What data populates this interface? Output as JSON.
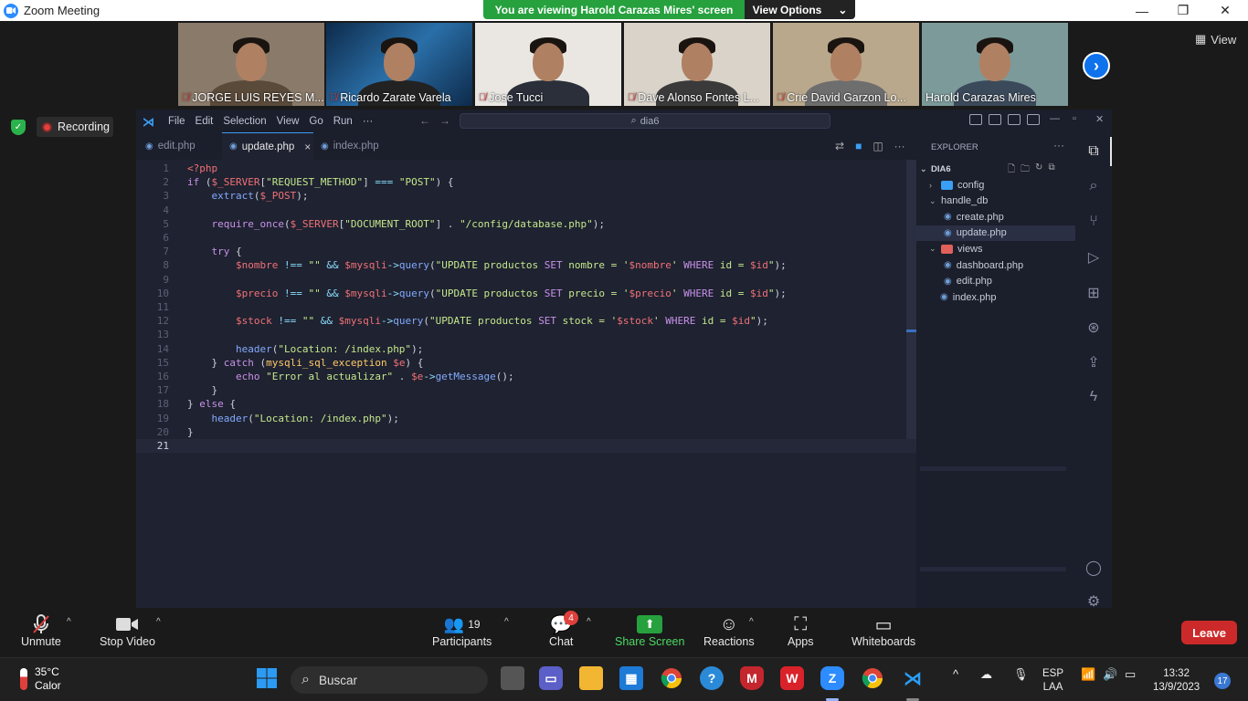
{
  "window": {
    "title": "Zoom Meeting",
    "controls": {
      "minimize": "—",
      "restore": "❐",
      "close": "✕"
    }
  },
  "share_banner": {
    "message": "You are viewing Harold Carazas Mires' screen",
    "options_label": "View Options"
  },
  "participants_strip": [
    {
      "name": "JORGE LUIS REYES M...",
      "muted": true,
      "bg": "#8a7a6a"
    },
    {
      "name": "Ricardo Zarate Varela",
      "muted": true,
      "bg": "#1f4e7a"
    },
    {
      "name": "Jose Tucci",
      "muted": true,
      "bg": "#e9e6e2"
    },
    {
      "name": "Dave Alonso Fontes L...",
      "muted": true,
      "bg": "#d8d2c8"
    },
    {
      "name": "Crie David Garzon Lo...",
      "muted": true,
      "bg": "#b9a88c"
    },
    {
      "name": "Harold Carazas Mires",
      "muted": false,
      "bg": "#7c9a9a"
    }
  ],
  "view_label": "View",
  "recording_label": "Recording",
  "vscode": {
    "menu": [
      "File",
      "Edit",
      "Selection",
      "View",
      "Go",
      "Run",
      "···"
    ],
    "search_text": "dia6",
    "tabs": [
      {
        "label": "edit.php",
        "active": false
      },
      {
        "label": "update.php",
        "active": true
      },
      {
        "label": "index.php",
        "active": false
      }
    ],
    "current_line": 21,
    "lines": [
      [
        [
          "tag",
          "<?php"
        ]
      ],
      [
        [
          "kw",
          "if"
        ],
        [
          "pl",
          " ("
        ],
        [
          "var",
          "$_SERVER"
        ],
        [
          "pl",
          "["
        ],
        [
          "str",
          "\"REQUEST_METHOD\""
        ],
        [
          "pl",
          "] "
        ],
        [
          "op",
          "==="
        ],
        [
          "pl",
          " "
        ],
        [
          "str",
          "\"POST\""
        ],
        [
          "pl",
          ") {"
        ]
      ],
      [
        [
          "pl",
          "    "
        ],
        [
          "fn",
          "extract"
        ],
        [
          "pl",
          "("
        ],
        [
          "var",
          "$_POST"
        ],
        [
          "pl",
          ");"
        ]
      ],
      [],
      [
        [
          "pl",
          "    "
        ],
        [
          "kw",
          "require_once"
        ],
        [
          "pl",
          "("
        ],
        [
          "var",
          "$_SERVER"
        ],
        [
          "pl",
          "["
        ],
        [
          "str",
          "\"DOCUMENT_ROOT\""
        ],
        [
          "pl",
          "] . "
        ],
        [
          "str",
          "\"/config/database.php\""
        ],
        [
          "pl",
          ");"
        ]
      ],
      [],
      [
        [
          "pl",
          "    "
        ],
        [
          "kw",
          "try"
        ],
        [
          "pl",
          " {"
        ]
      ],
      [
        [
          "pl",
          "        "
        ],
        [
          "var",
          "$nombre"
        ],
        [
          "pl",
          " "
        ],
        [
          "op",
          "!=="
        ],
        [
          "pl",
          " "
        ],
        [
          "str",
          "\"\""
        ],
        [
          "pl",
          " "
        ],
        [
          "op",
          "&&"
        ],
        [
          "pl",
          " "
        ],
        [
          "var",
          "$mysqli"
        ],
        [
          "op",
          "->"
        ],
        [
          "fn",
          "query"
        ],
        [
          "pl",
          "("
        ],
        [
          "str",
          "\"UPDATE productos "
        ],
        [
          "kw",
          "SET"
        ],
        [
          "str",
          " nombre = '"
        ],
        [
          "var",
          "$nombre"
        ],
        [
          "str",
          "' "
        ],
        [
          "kw",
          "WHERE"
        ],
        [
          "str",
          " id = "
        ],
        [
          "var",
          "$id"
        ],
        [
          "str",
          "\""
        ],
        [
          "pl",
          ");"
        ]
      ],
      [],
      [
        [
          "pl",
          "        "
        ],
        [
          "var",
          "$precio"
        ],
        [
          "pl",
          " "
        ],
        [
          "op",
          "!=="
        ],
        [
          "pl",
          " "
        ],
        [
          "str",
          "\"\""
        ],
        [
          "pl",
          " "
        ],
        [
          "op",
          "&&"
        ],
        [
          "pl",
          " "
        ],
        [
          "var",
          "$mysqli"
        ],
        [
          "op",
          "->"
        ],
        [
          "fn",
          "query"
        ],
        [
          "pl",
          "("
        ],
        [
          "str",
          "\"UPDATE productos "
        ],
        [
          "kw",
          "SET"
        ],
        [
          "str",
          " precio = '"
        ],
        [
          "var",
          "$precio"
        ],
        [
          "str",
          "' "
        ],
        [
          "kw",
          "WHERE"
        ],
        [
          "str",
          " id = "
        ],
        [
          "var",
          "$id"
        ],
        [
          "str",
          "\""
        ],
        [
          "pl",
          ");"
        ]
      ],
      [],
      [
        [
          "pl",
          "        "
        ],
        [
          "var",
          "$stock"
        ],
        [
          "pl",
          " "
        ],
        [
          "op",
          "!=="
        ],
        [
          "pl",
          " "
        ],
        [
          "str",
          "\"\""
        ],
        [
          "pl",
          " "
        ],
        [
          "op",
          "&&"
        ],
        [
          "pl",
          " "
        ],
        [
          "var",
          "$mysqli"
        ],
        [
          "op",
          "->"
        ],
        [
          "fn",
          "query"
        ],
        [
          "pl",
          "("
        ],
        [
          "str",
          "\"UPDATE productos "
        ],
        [
          "kw",
          "SET"
        ],
        [
          "str",
          " stock = '"
        ],
        [
          "var",
          "$stock"
        ],
        [
          "str",
          "' "
        ],
        [
          "kw",
          "WHERE"
        ],
        [
          "str",
          " id = "
        ],
        [
          "var",
          "$id"
        ],
        [
          "str",
          "\""
        ],
        [
          "pl",
          ");"
        ]
      ],
      [],
      [
        [
          "pl",
          "        "
        ],
        [
          "fn",
          "header"
        ],
        [
          "pl",
          "("
        ],
        [
          "str",
          "\"Location: /index.php\""
        ],
        [
          "pl",
          ");"
        ]
      ],
      [
        [
          "pl",
          "    } "
        ],
        [
          "kw",
          "catch"
        ],
        [
          "pl",
          " ("
        ],
        [
          "cls",
          "mysqli_sql_exception"
        ],
        [
          "pl",
          " "
        ],
        [
          "var",
          "$e"
        ],
        [
          "pl",
          ") {"
        ]
      ],
      [
        [
          "pl",
          "        "
        ],
        [
          "kw",
          "echo"
        ],
        [
          "pl",
          " "
        ],
        [
          "str",
          "\"Error al actualizar\""
        ],
        [
          "pl",
          " . "
        ],
        [
          "var",
          "$e"
        ],
        [
          "op",
          "->"
        ],
        [
          "fn",
          "getMessage"
        ],
        [
          "pl",
          "();"
        ]
      ],
      [
        [
          "pl",
          "    }"
        ]
      ],
      [
        [
          "pl",
          "} "
        ],
        [
          "kw",
          "else"
        ],
        [
          "pl",
          " {"
        ]
      ],
      [
        [
          "pl",
          "    "
        ],
        [
          "fn",
          "header"
        ],
        [
          "pl",
          "("
        ],
        [
          "str",
          "\"Location: /index.php\""
        ],
        [
          "pl",
          ");"
        ]
      ],
      [
        [
          "pl",
          "}"
        ]
      ],
      []
    ],
    "explorer": {
      "header": "EXPLORER",
      "root": "DIA6",
      "tree": [
        {
          "label": "config",
          "depth": 1,
          "type": "folder-cfg",
          "expanded": false,
          "selected": false
        },
        {
          "label": "handle_db",
          "depth": 1,
          "type": "folder",
          "expanded": true,
          "selected": false
        },
        {
          "label": "create.php",
          "depth": 2,
          "type": "php",
          "selected": false
        },
        {
          "label": "update.php",
          "depth": 2,
          "type": "php",
          "selected": true
        },
        {
          "label": "views",
          "depth": 1,
          "type": "folder-views",
          "expanded": true,
          "selected": false
        },
        {
          "label": "dashboard.php",
          "depth": 2,
          "type": "php",
          "selected": false
        },
        {
          "label": "edit.php",
          "depth": 2,
          "type": "php",
          "selected": false
        },
        {
          "label": "index.php",
          "depth": 1,
          "type": "php",
          "selected": false
        }
      ]
    }
  },
  "toolbar": {
    "unmute": "Unmute",
    "stop_video": "Stop Video",
    "participants": "Participants",
    "participants_count": "19",
    "chat": "Chat",
    "chat_badge": "4",
    "share_screen": "Share Screen",
    "reactions": "Reactions",
    "apps": "Apps",
    "whiteboards": "Whiteboards",
    "leave": "Leave"
  },
  "taskbar": {
    "temperature": "35°C",
    "weather": "Calor",
    "search_placeholder": "Buscar",
    "lang_1": "ESP",
    "lang_2": "LAA",
    "time": "13:32",
    "date": "13/9/2023",
    "notifications": "17"
  }
}
